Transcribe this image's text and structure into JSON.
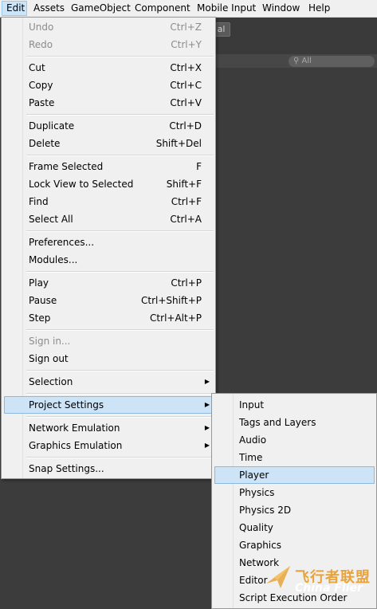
{
  "menubar": {
    "items": [
      {
        "label": "Edit"
      },
      {
        "label": "Assets"
      },
      {
        "label": "GameObject"
      },
      {
        "label": "Component"
      },
      {
        "label": "Mobile Input"
      },
      {
        "label": "Window"
      },
      {
        "label": "Help"
      }
    ]
  },
  "editor": {
    "toolbar_button_label": "al",
    "search_placeholder": "All"
  },
  "edit_menu": {
    "items": [
      {
        "label": "Undo",
        "shortcut": "Ctrl+Z"
      },
      {
        "label": "Redo",
        "shortcut": "Ctrl+Y"
      },
      {
        "label": "Cut",
        "shortcut": "Ctrl+X"
      },
      {
        "label": "Copy",
        "shortcut": "Ctrl+C"
      },
      {
        "label": "Paste",
        "shortcut": "Ctrl+V"
      },
      {
        "label": "Duplicate",
        "shortcut": "Ctrl+D"
      },
      {
        "label": "Delete",
        "shortcut": "Shift+Del"
      },
      {
        "label": "Frame Selected",
        "shortcut": "F"
      },
      {
        "label": "Lock View to Selected",
        "shortcut": "Shift+F"
      },
      {
        "label": "Find",
        "shortcut": "Ctrl+F"
      },
      {
        "label": "Select All",
        "shortcut": "Ctrl+A"
      },
      {
        "label": "Preferences...",
        "shortcut": ""
      },
      {
        "label": "Modules...",
        "shortcut": ""
      },
      {
        "label": "Play",
        "shortcut": "Ctrl+P"
      },
      {
        "label": "Pause",
        "shortcut": "Ctrl+Shift+P"
      },
      {
        "label": "Step",
        "shortcut": "Ctrl+Alt+P"
      },
      {
        "label": "Sign in...",
        "shortcut": ""
      },
      {
        "label": "Sign out",
        "shortcut": ""
      },
      {
        "label": "Selection",
        "shortcut": ""
      },
      {
        "label": "Project Settings",
        "shortcut": ""
      },
      {
        "label": "Network Emulation",
        "shortcut": ""
      },
      {
        "label": "Graphics Emulation",
        "shortcut": ""
      },
      {
        "label": "Snap Settings...",
        "shortcut": ""
      }
    ]
  },
  "project_settings_submenu": {
    "items": [
      {
        "label": "Input"
      },
      {
        "label": "Tags and Layers"
      },
      {
        "label": "Audio"
      },
      {
        "label": "Time"
      },
      {
        "label": "Player"
      },
      {
        "label": "Physics"
      },
      {
        "label": "Physics 2D"
      },
      {
        "label": "Quality"
      },
      {
        "label": "Graphics"
      },
      {
        "label": "Network"
      },
      {
        "label": "Editor"
      },
      {
        "label": "Script Execution Order"
      }
    ]
  },
  "watermark": {
    "cn": "飞行者联盟",
    "en": "China Flier"
  },
  "colors": {
    "menu_bg": "#f0f0f0",
    "highlight": "#cde3f6",
    "highlight_border": "#8fb8e0",
    "disabled_text": "#8c8c8c",
    "editor_bg": "#3c3c3c"
  }
}
